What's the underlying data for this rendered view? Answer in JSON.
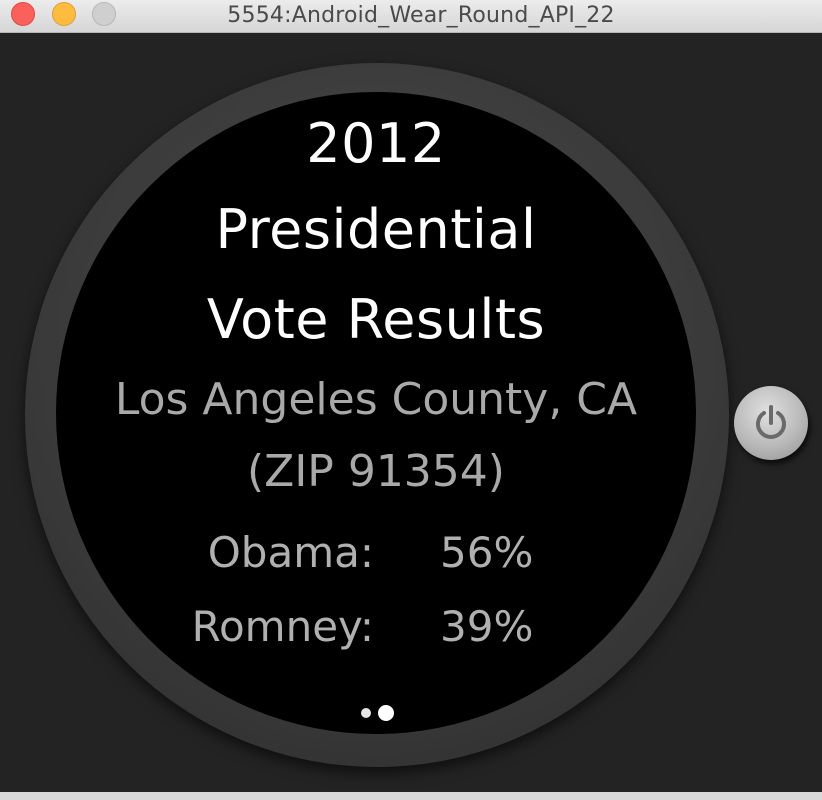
{
  "window": {
    "title": "5554:Android_Wear_Round_API_22"
  },
  "watch": {
    "title_lines": [
      "2012",
      "Presidential",
      "Vote Results"
    ],
    "location": "Los Angeles County, CA",
    "zip": "(ZIP 91354)",
    "results": [
      {
        "candidate": "Obama:",
        "percent": "56%"
      },
      {
        "candidate": "Romney:",
        "percent": "39%"
      }
    ],
    "page_indicator": {
      "pages": 2,
      "current": 2
    }
  },
  "icons": {
    "power": "power-icon"
  },
  "colors": {
    "screen_background": "#000000",
    "title_text": "#ffffff",
    "secondary_text": "#a9a9a9",
    "bezel": "#3a3a3a",
    "close": "#fc605b",
    "minimize": "#fdbc40",
    "zoom": "#cfcfcf"
  }
}
